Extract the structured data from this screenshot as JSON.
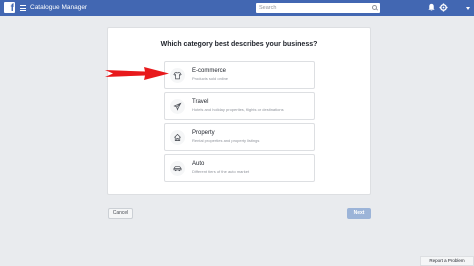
{
  "topbar": {
    "logo_letter": "f",
    "app_title": "Catalogue Manager",
    "search_placeholder": "Search",
    "icons": [
      "menu-icon",
      "search-icon",
      "bell-icon",
      "gear-icon",
      "chevron-down-icon"
    ]
  },
  "dialog": {
    "question": "Which category best describes your business?",
    "options": [
      {
        "title": "E-commerce",
        "description": "Products sold online",
        "icon": "shirt-icon"
      },
      {
        "title": "Travel",
        "description": "Hotels and holiday properties, flights or destinations",
        "icon": "plane-icon"
      },
      {
        "title": "Property",
        "description": "Rental properties and property listings",
        "icon": "house-icon"
      },
      {
        "title": "Auto",
        "description": "Different tiers of the auto market",
        "icon": "car-icon"
      }
    ]
  },
  "footer": {
    "cancel_label": "Cancel",
    "next_label": "Next",
    "report_label": "Report a Problem"
  },
  "colors": {
    "topbar": "#4267b2",
    "background": "#e9ebee",
    "annotation_arrow": "#e8191c",
    "next_disabled": "#9cb4d8"
  }
}
